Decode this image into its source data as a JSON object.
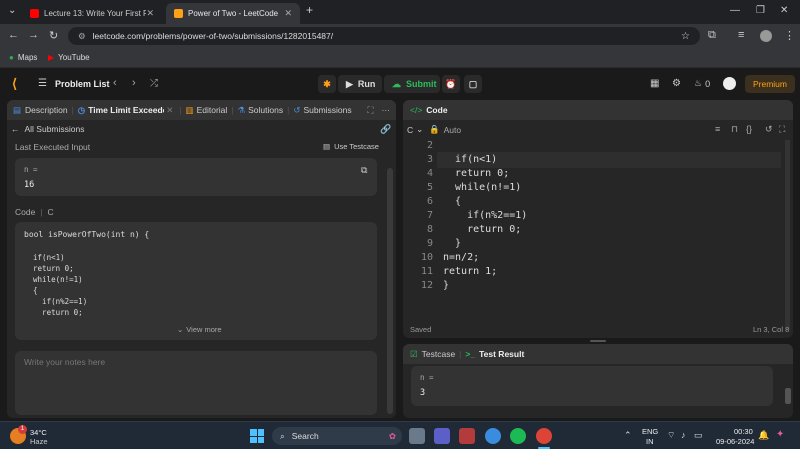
{
  "browser": {
    "tabs": [
      {
        "title": "Lecture 13: Write Your First Pro",
        "active": false
      },
      {
        "title": "Power of Two - LeetCode",
        "active": true
      }
    ],
    "url": "leetcode.com/problems/power-of-two/submissions/1282015487/",
    "bookmarks": [
      "Maps",
      "YouTube"
    ]
  },
  "lc": {
    "problem_list": "Problem List",
    "run": "Run",
    "submit": "Submit",
    "fire_count": "0",
    "premium": "Premium"
  },
  "left": {
    "tabs": [
      "Description",
      "Time Limit Exceeded",
      "Editorial",
      "Solutions",
      "Submissions"
    ],
    "all_submissions": "All Submissions",
    "last_input_title": "Last Executed Input",
    "use_testcase": "Use Testcase",
    "input_label": "n =",
    "input_value": "16",
    "code_label": "Code",
    "code_lang": "C",
    "code_lines": [
      "bool isPowerOfTwo(int n) {",
      "",
      "  if(n<1)",
      "  return 0;",
      "  while(n!=1)",
      "  {",
      "    if(n%2==1)",
      "    return 0;"
    ],
    "view_more": "View more",
    "notes_placeholder": "Write your notes here"
  },
  "right": {
    "title": "Code",
    "lang": "C",
    "auto": "Auto",
    "line_numbers": [
      "2",
      "3",
      "4",
      "5",
      "6",
      "7",
      "8",
      "9",
      "10",
      "11",
      "12"
    ],
    "lines": [
      "",
      "  if(n<1)",
      "  return 0;",
      "  while(n!=1)",
      "  {",
      "    if(n%2==1)",
      "    return 0;",
      "  }",
      "n=n/2;",
      "return 1;",
      "}"
    ],
    "saved": "Saved",
    "cursor": "Ln 3, Col 8",
    "testcase_tab": "Testcase",
    "result_tab": "Test Result",
    "result_label": "n =",
    "result_value": "3"
  },
  "taskbar": {
    "temp": "34°C",
    "weather": "Haze",
    "search": "Search",
    "lang1": "ENG",
    "lang2": "IN",
    "time": "00:30",
    "date": "09-06-2024",
    "badge": "1"
  },
  "colors": {
    "accent_green": "#2cbb5d",
    "premium": "#ffa116",
    "taskbar": "#1f2a36"
  }
}
